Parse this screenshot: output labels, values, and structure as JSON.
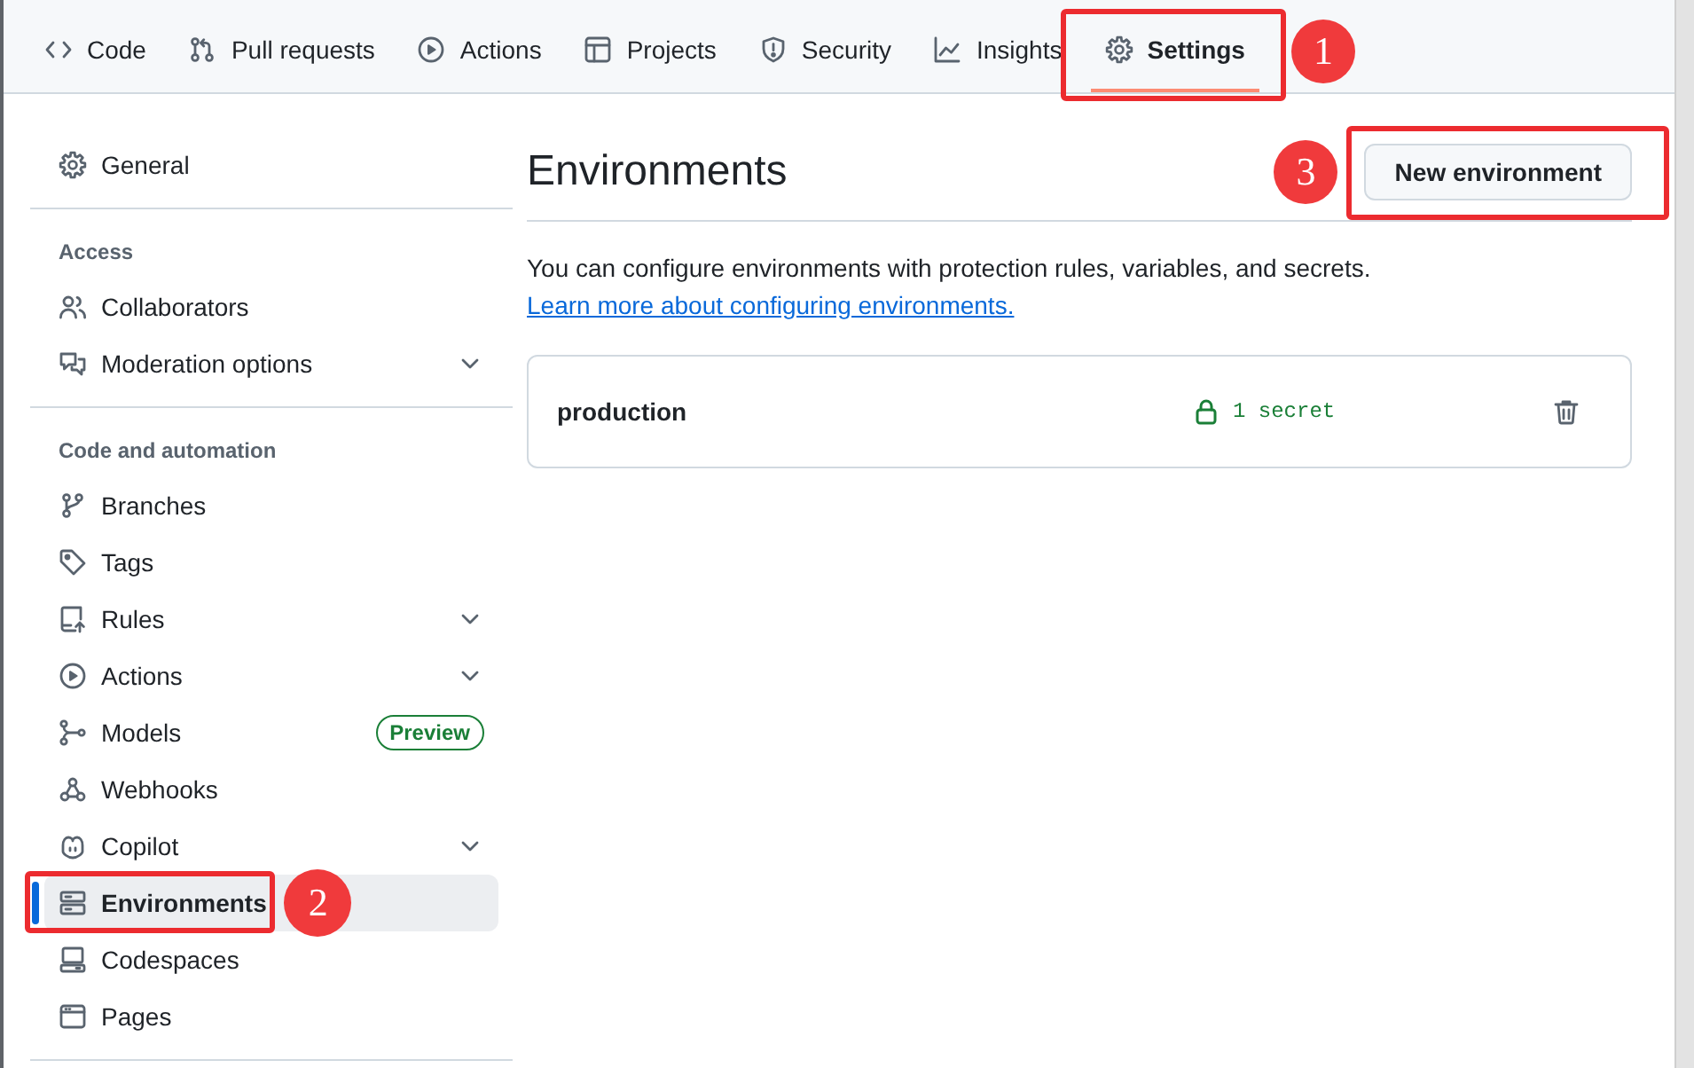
{
  "repo_nav": {
    "tabs": [
      {
        "label": "Code",
        "selected": false
      },
      {
        "label": "Pull requests",
        "selected": false
      },
      {
        "label": "Actions",
        "selected": false
      },
      {
        "label": "Projects",
        "selected": false
      },
      {
        "label": "Security",
        "selected": false
      },
      {
        "label": "Insights",
        "selected": false
      },
      {
        "label": "Settings",
        "selected": true,
        "callout": "1"
      }
    ]
  },
  "sidebar": {
    "sections": [
      {
        "items": [
          {
            "label": "General",
            "selected": false
          }
        ]
      },
      {
        "heading": "Access",
        "items": [
          {
            "label": "Collaborators",
            "selected": false
          },
          {
            "label": "Moderation options",
            "selected": false,
            "expanded": false
          }
        ]
      },
      {
        "heading": "Code and automation",
        "items": [
          {
            "label": "Branches",
            "selected": false
          },
          {
            "label": "Tags",
            "selected": false
          },
          {
            "label": "Rules",
            "selected": false,
            "expanded": false
          },
          {
            "label": "Actions",
            "selected": false,
            "expanded": false
          },
          {
            "label": "Models",
            "selected": false,
            "badge": "Preview"
          },
          {
            "label": "Webhooks",
            "selected": false
          },
          {
            "label": "Copilot",
            "selected": false,
            "expanded": false
          },
          {
            "label": "Environments",
            "selected": true,
            "callout": "2"
          },
          {
            "label": "Codespaces",
            "selected": false
          },
          {
            "label": "Pages",
            "selected": false
          }
        ]
      }
    ]
  },
  "main": {
    "title": "Environments",
    "new_button": {
      "label": "New environment",
      "callout": "3"
    },
    "description": "You can configure environments with protection rules, variables, and secrets.",
    "learn_more_link": "Learn more about configuring environments.",
    "environments": [
      {
        "name": "production",
        "secrets": "1 secret"
      }
    ]
  }
}
